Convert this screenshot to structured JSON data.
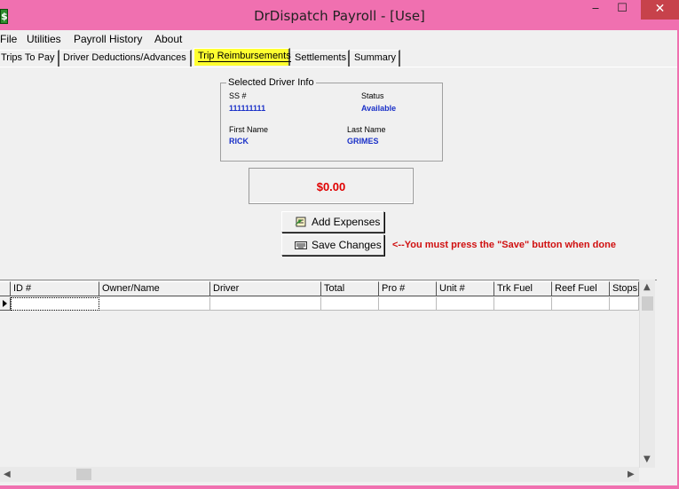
{
  "window": {
    "title": "DrDispatch Payroll - [Use]",
    "app_icon_glyph": "$",
    "minimize_glyph": "‒",
    "maximize_glyph": "☐",
    "close_glyph": "✕"
  },
  "menu": {
    "items": [
      "File",
      "Utilities",
      "Payroll History",
      "About"
    ]
  },
  "tabs": [
    {
      "label": "Trips To Pay",
      "active": false
    },
    {
      "label": "Driver Deductions/Advances",
      "active": false
    },
    {
      "label": "Trip Reimbursements",
      "active": true
    },
    {
      "label": "Settlements",
      "active": false
    },
    {
      "label": "Summary",
      "active": false
    }
  ],
  "driver_info": {
    "legend": "Selected Driver Info",
    "ssn_label": "SS #",
    "ssn_value": "111111111",
    "status_label": "Status",
    "status_value": "Available",
    "first_name_label": "First Name",
    "first_name_value": "RICK",
    "last_name_label": "Last Name",
    "last_name_value": "GRIMES"
  },
  "total": {
    "amount": "$0.00",
    "color": "#e00000"
  },
  "buttons": {
    "add_expenses": "Add Expenses",
    "save_changes": "Save Changes"
  },
  "save_note": "<--You must press the \"Save\" button when done",
  "grid": {
    "columns": [
      "ID #",
      "Owner/Name",
      "Driver",
      "Total",
      "Pro #",
      "Unit #",
      "Trk Fuel",
      "Reef Fuel",
      "Stops"
    ]
  },
  "colors": {
    "title_bar": "#f070b0",
    "active_tab_highlight": "#ffff30",
    "value_text": "#1a30c8",
    "close_button": "#c7424b"
  }
}
